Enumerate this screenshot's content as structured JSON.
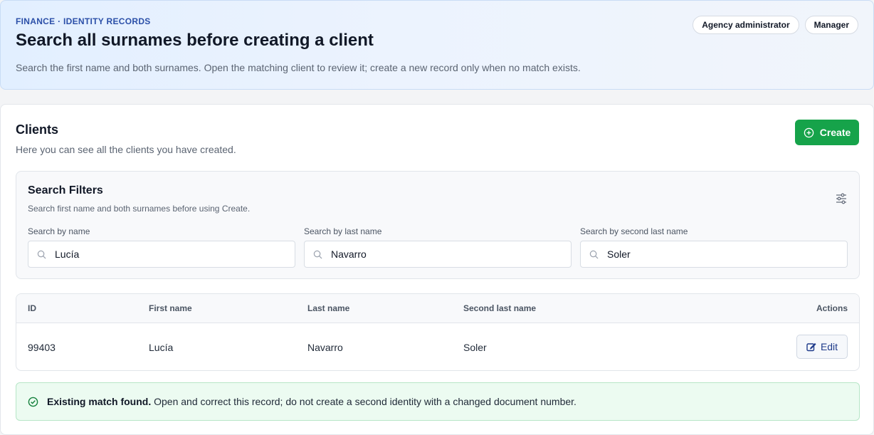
{
  "banner": {
    "eyebrow": "FINANCE · IDENTITY RECORDS",
    "title": "Search all surnames before creating a client",
    "description": "Search the first name and both surnames. Open the matching client to review it; create a new record only when no match exists.",
    "roles": [
      "Agency administrator",
      "Manager"
    ]
  },
  "clients": {
    "title": "Clients",
    "subtitle": "Here you can see all the clients you have created.",
    "create_label": "Create",
    "create_icon": "plus-circle-icon"
  },
  "filters": {
    "title": "Search Filters",
    "subtitle": "Search first name and both surnames before using Create.",
    "icon": "sliders-icon",
    "fields": [
      {
        "label": "Search by name",
        "value": "Lucía"
      },
      {
        "label": "Search by last name",
        "value": "Navarro"
      },
      {
        "label": "Search by second last name",
        "value": "Soler"
      }
    ]
  },
  "table": {
    "columns": [
      "ID",
      "First name",
      "Last name",
      "Second last name",
      "Actions"
    ],
    "rows": [
      {
        "id": "99403",
        "first_name": "Lucía",
        "last_name": "Navarro",
        "second_last_name": "Soler",
        "action_label": "Edit"
      }
    ]
  },
  "alert": {
    "bold": "Existing match found.",
    "text": " Open and correct this record; do not create a second identity with a changed document number.",
    "icon": "check-circle-icon"
  },
  "colors": {
    "accent": "#2b4fa8",
    "create": "#16a34a",
    "success_bg": "#ecfbf1"
  }
}
